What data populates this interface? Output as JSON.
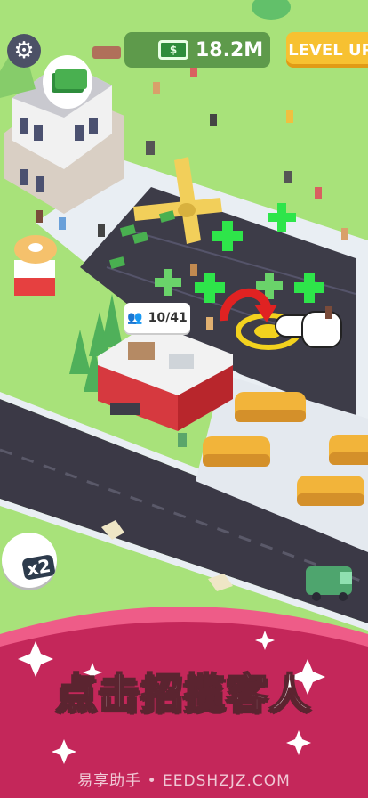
{
  "hud": {
    "money_value": "18.2M",
    "money_icon": "cash-bill-icon",
    "level_up_label": "LEVEL UP",
    "settings_icon": "gear-icon"
  },
  "map": {
    "visitor_counter": "10/41",
    "visitor_icon": "people-group-icon",
    "booster_label": "x2",
    "booster_icon": "cash-stack-icon"
  },
  "tutorial": {
    "hand_icon": "pointing-hand-icon",
    "arrow_icon": "curved-arrow-icon"
  },
  "banner": {
    "title": "点击招揽客人",
    "watermark": "易享助手 • EEDSHZJZ.COM"
  },
  "colors": {
    "grass": "#a8e27a",
    "lot": "#3d3c48",
    "road": "#3b3946",
    "plus_green": "#2ee54a",
    "banner_red": "#c4275a",
    "banner_top": "#ee5c88",
    "level_yellow": "#f7c131",
    "money_green": "#5e9a4b"
  }
}
